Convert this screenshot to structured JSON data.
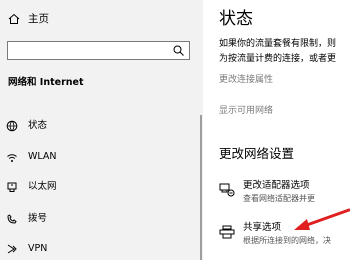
{
  "sidebar": {
    "home_label": "主页",
    "search_placeholder": "",
    "section_title": "网络和 Internet",
    "items": [
      {
        "label": "状态",
        "icon": "globe-icon"
      },
      {
        "label": "WLAN",
        "icon": "wifi-icon"
      },
      {
        "label": "以太网",
        "icon": "ethernet-icon"
      },
      {
        "label": "拨号",
        "icon": "phone-icon"
      },
      {
        "label": "VPN",
        "icon": "vpn-icon"
      }
    ]
  },
  "main": {
    "title": "状态",
    "description_line1": "如果你的流量套餐有限制，则",
    "description_line2": "为按流量计费的连接，或者更",
    "link_change_properties": "更改连接属性",
    "link_show_networks": "显示可用网络",
    "section_title": "更改网络设置",
    "options": [
      {
        "title": "更改适配器选项",
        "desc": "查看网络适配器并更",
        "icon": "adapter-icon"
      },
      {
        "title": "共享选项",
        "desc": "根据所连接到的网络，决",
        "icon": "sharing-icon"
      }
    ]
  },
  "colors": {
    "sidebar_bg": "#f2f2f2",
    "link_gray": "#7a7a7a",
    "arrow_red": "#e02020"
  }
}
